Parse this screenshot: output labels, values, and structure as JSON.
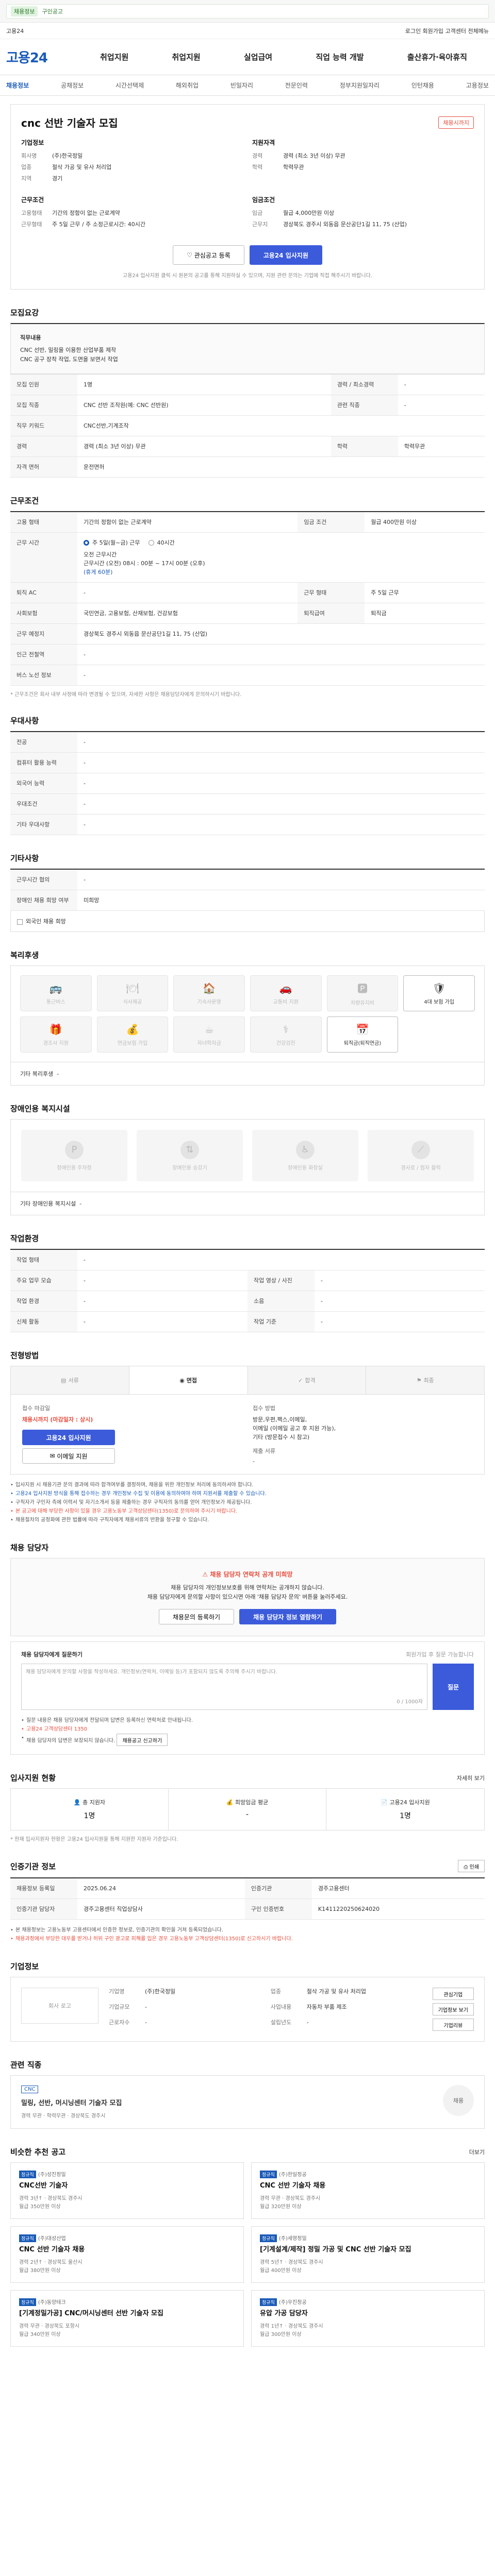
{
  "topbar": {
    "badge": "채용정보",
    "text": "구인공고",
    "right": ""
  },
  "brand_row": {
    "left": "고용24",
    "right": "로그인  회원가입  고객센터  전체메뉴"
  },
  "header": {
    "logo_main": "고용",
    "logo_sub": "24",
    "nav": [
      "취업지원",
      "취업지원",
      "실업급여",
      "직업 능력 개발",
      "출산휴가·육아휴직"
    ]
  },
  "sub_tabs": [
    "채용정보",
    "공채정보",
    "시간선택제",
    "해외취업",
    "빈일자리",
    "전문인력",
    "정부지원일자리",
    "인턴채용",
    "고용정보"
  ],
  "job": {
    "title": "cnc 선반 기술자 모집",
    "deadline": "채용시까지",
    "company_head": "기업정보",
    "conditions_head": "지원자격",
    "company_rows": [
      {
        "k": "회사명",
        "v": "(주)한국정밀"
      },
      {
        "k": "업종",
        "v": "절삭 가공 및 유사 처리업"
      },
      {
        "k": "지역",
        "v": "경기"
      }
    ],
    "conditions_rows": [
      {
        "k": "경력",
        "v": "경력 (최소 3년 이상) 무관"
      },
      {
        "k": "학력",
        "v": "학력무관"
      }
    ],
    "work_head": "근무조건",
    "work_rows": [
      {
        "k": "고용형태",
        "v": "기간의 정함이 없는 근로계약"
      },
      {
        "k": "근무형태",
        "v": "주 5일 근무 / 주 소정근로시간: 40시간"
      }
    ],
    "pay_head": "임금조건",
    "pay_rows": [
      {
        "k": "임금",
        "v": "월급 4,000만원 이상"
      },
      {
        "k": "근무지",
        "v": "경상북도 경주시 외동읍 문산공단1길 11, 75 (산업)"
      }
    ],
    "place_head": "근무예정지",
    "place_rows": [
      {
        "k": "근무예정지",
        "v": "경상북도 경주시 외동읍"
      },
      {
        "k": "인근전철역",
        "v": "-"
      }
    ],
    "btn_interest": "관심공고 등록",
    "btn_apply": "고용24 입사지원",
    "note": "고용24 입사지원 클릭 시 원본의 공고를 통해 지원하실 수 있으며, 지원 관련 문의는 기업에 직접 해주시기 바랍니다."
  },
  "recruit": {
    "title": "모집요강",
    "desc_head": "직무내용",
    "desc": "CNC 선반, 밀링을 이용한 산업부품 제작\nCNC 공구 장착 작업, 도면을 보면서 작업",
    "rows": [
      {
        "k": "모집 인원",
        "v": "1명",
        "k2": "경력 / 최소경력",
        "v2": "-"
      },
      {
        "k": "모집 직종",
        "v": "CNC 선반 조작원(예: CNC 선반원)",
        "k2": "관련 직종",
        "v2": "-"
      },
      {
        "k": "직무 키워드",
        "v": "CNC선반,기계조작",
        "k2": "",
        "v2": ""
      },
      {
        "k": "경력",
        "v": "경력 (최소 3년 이상) 무관",
        "k2": "학력",
        "v2": "학력무관"
      },
      {
        "k": "자격 면허",
        "v": "운전면허",
        "k2": "",
        "v2": ""
      }
    ]
  },
  "work_cond": {
    "title": "근무조건",
    "rows": [
      {
        "k": "고용 형태",
        "v": "기간의 정함이 없는 근로계약",
        "k2": "임금 조건",
        "v2": "월급 400만원 이상"
      }
    ],
    "time_head": "근무 시간",
    "radio_main": "주 5일(월~금) 근무",
    "radio_sub": "40시간",
    "time_lines": [
      "오전 근무시간",
      "근무시간 (오전) 08시 : 00분 ~ 17시 00분 (오후)",
      "(휴게 60분)"
    ],
    "rows2": [
      {
        "k": "퇴직 AC",
        "v": "-",
        "k2": "근무 형태",
        "v2": "주 5일 근무"
      },
      {
        "k": "사회보험",
        "v": "국민연금, 고용보험, 산재보험, 건강보험",
        "k2": "퇴직급여",
        "v2": "퇴직금"
      },
      {
        "k": "근무 예정지",
        "v": "경상북도 경주시 외동읍 문산공단1길 11, 75 (산업)",
        "k2": "",
        "v2": ""
      },
      {
        "k": "인근 전철역",
        "v": "-",
        "k2": "",
        "v2": ""
      },
      {
        "k": "버스 노선 정보",
        "v": "-",
        "k2": "",
        "v2": ""
      }
    ],
    "footnote": "* 근무조건은 회사 내부 사정에 따라 변경될 수 있으며, 자세한 사항은 채용담당자에게 문의하시기 바랍니다."
  },
  "preferential": {
    "title": "우대사항",
    "rows": [
      {
        "k": "전공",
        "v": "-"
      },
      {
        "k": "컴퓨터 활용 능력",
        "v": "-"
      },
      {
        "k": "외국어 능력",
        "v": "-"
      },
      {
        "k": "우대조건",
        "v": "-"
      },
      {
        "k": "기타 우대사항",
        "v": "-"
      }
    ]
  },
  "etc": {
    "title": "기타사항",
    "rows": [
      {
        "k": "근무시간 협의",
        "v": "-"
      },
      {
        "k": "장애인 채용 희망 여부",
        "v": "미희망"
      }
    ],
    "check": "외국인 채용 희망"
  },
  "welfare": {
    "title": "복리후생",
    "items": [
      {
        "icon": "bus-icon",
        "glyph": "🚌",
        "label": "통근버스",
        "on": false
      },
      {
        "icon": "meal-icon",
        "glyph": "🍽",
        "label": "식사제공",
        "on": false
      },
      {
        "icon": "house-icon",
        "glyph": "🏠",
        "label": "기숙사운영",
        "on": false
      },
      {
        "icon": "car-icon",
        "glyph": "🚗",
        "label": "교통비 지원",
        "on": false
      },
      {
        "icon": "parking-icon",
        "glyph": "🅿",
        "label": "차량유지비",
        "on": false
      },
      {
        "icon": "insurance-icon",
        "glyph": "🛡",
        "label": "4대 보험 가입",
        "on": true
      },
      {
        "icon": "gift-icon",
        "glyph": "🎁",
        "label": "경조사 지원",
        "on": false
      },
      {
        "icon": "bonus-icon",
        "glyph": "💰",
        "label": "연금보험 가입",
        "on": false
      },
      {
        "icon": "cafe-icon",
        "glyph": "☕",
        "label": "자녀학자금",
        "on": false
      },
      {
        "icon": "health-icon",
        "glyph": "⚕",
        "label": "건강검진",
        "on": false
      },
      {
        "icon": "calendar-icon",
        "glyph": "📅",
        "label": "퇴직금(퇴직연금)",
        "on": true
      }
    ],
    "other_label": "기타 복리후생",
    "other_value": "-"
  },
  "facility": {
    "title": "장애인용 복지시설",
    "items": [
      {
        "icon": "parking-icon",
        "glyph": "P",
        "label": "장애인용 주차장"
      },
      {
        "icon": "elevator-icon",
        "glyph": "⇅",
        "label": "장애인용 승강기"
      },
      {
        "icon": "toilet-icon",
        "glyph": "♿",
        "label": "장애인용 화장실"
      },
      {
        "icon": "ramp-icon",
        "glyph": "⟋",
        "label": "경사로 / 점자 블럭"
      }
    ],
    "other_label": "기타 장애인용 복지시설",
    "other_value": "-"
  },
  "company_env": {
    "title": "작업환경",
    "rows": [
      {
        "k": "작업 형태",
        "v": "-",
        "k2": "",
        "v2": ""
      },
      {
        "k": "주요 업무 모습",
        "v": "-",
        "k2": "작업 영상 / 사진",
        "v2": "-"
      },
      {
        "k": "작업 환경",
        "v": "-",
        "k2": "소음",
        "v2": "-"
      },
      {
        "k": "신체 활동",
        "v": "-",
        "k2": "작업 기준",
        "v2": "-"
      }
    ]
  },
  "process": {
    "title": "전형방법",
    "steps": [
      "서류",
      "면접",
      "합격",
      "최종"
    ],
    "deadline_label": "접수 마감일",
    "deadline_value": "채용시까지 (마감일자 : 상시)",
    "apply_btn": "고용24 입사지원",
    "email_btn": "이메일 지원",
    "method_label": "접수 방법",
    "method_value": "방문,우편,팩스,이메일,\n이메일 (이메일 공고 후 지원 가능),\n기타 (방문접수 시 참고)",
    "docs_label": "제출 서류",
    "docs_value": "-",
    "bullets": [
      "입사지원 시 채용기관 문의 결과에 따라 합격여부를 결정하며, 채용을 위한 개인정보 처리에 동의하셔야 합니다.",
      "고용24 입사지원 방식을 통해 접수하는 경우 개인정보 수집 및 이용에 동의하여야 하며 지원서를 제출할 수 있습니다.",
      "구직자가 구인자 측에 이력서 및 자기소개서 등을 제출하는 경우 구직자의 동의를 얻어 개인정보가 제공됩니다.",
      "본 공고에 대해 부당한 사항이 있을 경우 고용노동부 고객상담센터(1350)로 문의하여 주시기 바랍니다.",
      "채용절차의 공정화에 관한 법률에 따라 구직자에게 채용서류의 반환을 청구할 수 있습니다."
    ]
  },
  "recruiter": {
    "title": "채용 담당자",
    "warn": "채용 담당자 연락처 공개 미희망",
    "body": "채용 담당자의 개인정보보호를 위해 연락처는 공개하지 않습니다.\n채용 담당자에게 문의할 사항이 있으시면 아래 '채용 담당자 문의' 버튼을 눌러주세요.",
    "btn_1": "채용문의 등록하기",
    "btn_2": "채용 담당자 정보 열람하기",
    "qa_head": "채용 담당자에게 질문하기",
    "qa_right": "회원가입 후 질문 가능합니다",
    "qa_placeholder": "채용 담당자에게 문의할 사항을 작성하세요. 개인정보(연락처, 이메일 등)가 포함되지 않도록 주의해 주시기 바랍니다.",
    "qa_count": "0 / 1000자",
    "qa_btn": "질문",
    "qa_notes": [
      "질문 내용은 채용 담당자에게 전달되며 답변은 등록하신 연락처로 안내됩니다.",
      "고용24 고객상담센터 1350",
      "채용 담당자의 답변은 보장되지 않습니다."
    ],
    "qa_link": "채용공고 신고하기"
  },
  "stats": {
    "title": "입사지원 현황",
    "more": "자세히 보기",
    "items": [
      {
        "label": "총 지원자",
        "value": "1명"
      },
      {
        "label": "희망임금 평균",
        "value": "-"
      },
      {
        "label": "고용24 입사지원",
        "value": "1명"
      }
    ],
    "note": "* 현재 입사지원자 현황은 고용24 입사지원을 통해 지원한 지원자 기준입니다."
  },
  "posting": {
    "title": "인증기관 정보",
    "print": "인쇄",
    "rows": [
      {
        "k": "채용정보 등록일",
        "v": "2025.06.24",
        "k2": "인증기관",
        "v2": "경주고용센터"
      },
      {
        "k": "인증기관 담당자",
        "v": "경주고용센터 직업상담사",
        "k2": "구인 인증번호",
        "v2": "K1411220250624020"
      }
    ],
    "notes": [
      "본 채용정보는 고용노동부 고용센터에서 인증한 정보로, 인증기관의 확인을 거쳐 등록되었습니다.",
      "채용과정에서 부당한 대우를 받거나 허위 구인 광고로 피해를 입은 경우 고용노동부 고객상담센터(1350)로 신고하시기 바랍니다."
    ]
  },
  "company": {
    "title": "기업정보",
    "logo_alt": "회사 로고",
    "rows": [
      {
        "k": "기업명",
        "v": "(주)한국정밀"
      },
      {
        "k": "업종",
        "v": "절삭 가공 및 유사 처리업"
      },
      {
        "k": "기업규모",
        "v": "-"
      },
      {
        "k": "사업내용",
        "v": "자동차 부품 제조"
      },
      {
        "k": "근로자수",
        "v": "-"
      },
      {
        "k": "설립년도",
        "v": "-"
      }
    ],
    "btn_1": "관심기업",
    "btn_2": "기업정보 보기",
    "btn_3": "기업리뷰"
  },
  "related": {
    "title": "관련 직종",
    "tag": "CNC",
    "ttitle": "밀링, 선반, 머시닝센터 기술자 모집",
    "meta": "경력 무관 · 학력무관 · 경상북도 경주시",
    "right": "채용"
  },
  "reco": {
    "title": "비슷한 추천 공고",
    "more": "더보기",
    "cards": [
      {
        "tag": "정규직",
        "company": "(주)성진정밀",
        "title": "CNC선반 기술자",
        "meta": "경력 3년↑ · 경상북도 경주시\n월급 350만원 이상"
      },
      {
        "tag": "정규직",
        "company": "(주)한일정공",
        "title": "CNC 선반 기술자 채용",
        "meta": "경력 무관 · 경상북도 경주시\n월급 320만원 이상"
      },
      {
        "tag": "정규직",
        "company": "(주)대성산업",
        "title": "CNC 선반 기술자 채용",
        "meta": "경력 2년↑ · 경상북도 울산시\n월급 380만원 이상"
      },
      {
        "tag": "정규직",
        "company": "(주)세영정밀",
        "title": "[기계설계/제작] 정밀 가공 및 CNC 선반 기술자 모집",
        "meta": "경력 5년↑ · 경상북도 경주시\n월급 400만원 이상"
      },
      {
        "tag": "정규직",
        "company": "(주)동양테크",
        "title": "[기계정밀가공] CNC/머시닝센터 선반 기술자 모집",
        "meta": "경력 무관 · 경상북도 포항시\n월급 340만원 이상"
      },
      {
        "tag": "정규직",
        "company": "(주)우진정공",
        "title": "유압 가공 담당자",
        "meta": "경력 1년↑ · 경상북도 경주시\n월급 300만원 이상"
      }
    ]
  }
}
